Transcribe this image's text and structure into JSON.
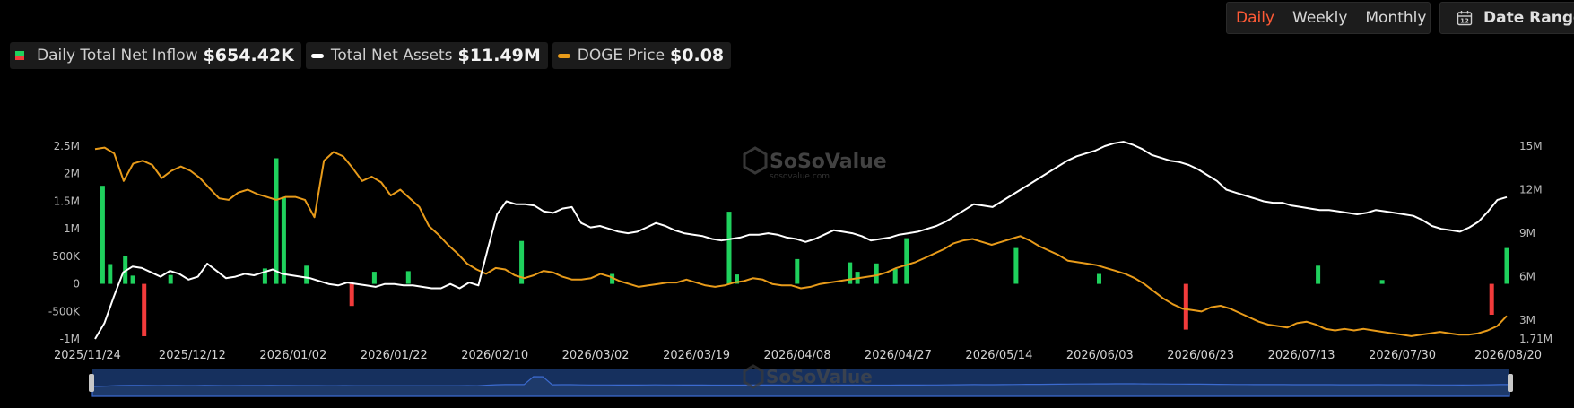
{
  "period_options": [
    {
      "label": "Daily",
      "active": true
    },
    {
      "label": "Weekly",
      "active": false
    },
    {
      "label": "Monthly",
      "active": false
    }
  ],
  "date_range_label": "Date Range",
  "date_range_icon": "calendar-icon",
  "legend": [
    {
      "label": "Daily Total Net Inflow",
      "value": "$654.42K"
    },
    {
      "label": "Total Net Assets",
      "value": "$11.49M"
    },
    {
      "label": "DOGE Price",
      "value": "$0.08"
    }
  ],
  "watermark": {
    "brand": "SoSoValue",
    "site": "sosovalue.com"
  },
  "colors": {
    "inflow_positive": "#1fd15d",
    "inflow_negative": "#f23b3b",
    "net_assets": "#ffffff",
    "doge_price": "#e89b1a",
    "navigator_fill": "#1e3a6a",
    "navigator_line": "#3c6bd0"
  },
  "chart_data": {
    "type": "bar+line",
    "x_labels": [
      "2025/11/24",
      "2025/12/12",
      "2026/01/02",
      "2026/01/22",
      "2026/02/10",
      "2026/03/02",
      "2026/03/19",
      "2026/04/08",
      "2026/04/27",
      "2026/05/14",
      "2026/06/03",
      "2026/06/23",
      "2026/07/13",
      "2026/07/30",
      "2026/08/20"
    ],
    "left_axis": {
      "ticks": [
        "2.5M",
        "2M",
        "1.5M",
        "1M",
        "500K",
        "0",
        "-500K",
        "-1M"
      ],
      "min": -1000000,
      "max": 2500000
    },
    "right_axis": {
      "ticks": [
        "15M",
        "12M",
        "9M",
        "6M",
        "3M",
        "1.71M"
      ],
      "min": 1710000,
      "max": 15000000
    },
    "series": [
      {
        "name": "Daily Total Net Inflow",
        "kind": "bar",
        "axis": "left",
        "points": [
          [
            2,
            1780000
          ],
          [
            4,
            360000
          ],
          [
            8,
            500000
          ],
          [
            10,
            150000
          ],
          [
            13,
            -950000
          ],
          [
            20,
            160000
          ],
          [
            45,
            280000
          ],
          [
            48,
            2280000
          ],
          [
            50,
            1580000
          ],
          [
            56,
            330000
          ],
          [
            68,
            -400000
          ],
          [
            74,
            220000
          ],
          [
            83,
            230000
          ],
          [
            113,
            780000
          ],
          [
            137,
            180000
          ],
          [
            168,
            1310000
          ],
          [
            170,
            170000
          ],
          [
            186,
            450000
          ],
          [
            200,
            390000
          ],
          [
            202,
            220000
          ],
          [
            207,
            370000
          ],
          [
            212,
            270000
          ],
          [
            215,
            830000
          ],
          [
            244,
            650000
          ],
          [
            266,
            180000
          ],
          [
            289,
            -830000
          ],
          [
            324,
            330000
          ],
          [
            341,
            70000
          ],
          [
            370,
            -560000
          ],
          [
            374,
            650000
          ]
        ]
      },
      {
        "name": "Total Net Assets",
        "kind": "line",
        "axis": "right",
        "x_range": [
          0,
          374
        ],
        "values": [
          1.71,
          2.8,
          4.6,
          6.3,
          6.7,
          6.6,
          6.3,
          6.0,
          6.4,
          6.2,
          5.8,
          6.0,
          6.9,
          6.4,
          5.9,
          6.0,
          6.2,
          6.1,
          6.3,
          6.5,
          6.2,
          6.1,
          6.0,
          5.9,
          5.7,
          5.5,
          5.4,
          5.6,
          5.5,
          5.4,
          5.3,
          5.5,
          5.5,
          5.4,
          5.4,
          5.3,
          5.2,
          5.2,
          5.5,
          5.2,
          5.6,
          5.4,
          7.9,
          10.3,
          11.2,
          11.0,
          11.0,
          10.9,
          10.5,
          10.4,
          10.7,
          10.8,
          9.7,
          9.4,
          9.5,
          9.3,
          9.1,
          9.0,
          9.1,
          9.4,
          9.7,
          9.5,
          9.2,
          9.0,
          8.9,
          8.8,
          8.6,
          8.5,
          8.6,
          8.7,
          8.9,
          8.9,
          9.0,
          8.9,
          8.7,
          8.6,
          8.4,
          8.6,
          8.9,
          9.2,
          9.1,
          9.0,
          8.8,
          8.5,
          8.6,
          8.7,
          8.9,
          9.0,
          9.1,
          9.3,
          9.5,
          9.8,
          10.2,
          10.6,
          11.0,
          10.9,
          10.8,
          11.2,
          11.6,
          12.0,
          12.4,
          12.8,
          13.2,
          13.6,
          14.0,
          14.3,
          14.5,
          14.7,
          15.0,
          15.2,
          15.3,
          15.1,
          14.8,
          14.4,
          14.2,
          14.0,
          13.9,
          13.7,
          13.4,
          13.0,
          12.6,
          12.0,
          11.8,
          11.6,
          11.4,
          11.2,
          11.1,
          11.1,
          10.9,
          10.8,
          10.7,
          10.6,
          10.6,
          10.5,
          10.4,
          10.3,
          10.4,
          10.6,
          10.5,
          10.4,
          10.3,
          10.2,
          9.9,
          9.5,
          9.3,
          9.2,
          9.1,
          9.4,
          9.8,
          10.5,
          11.3,
          11.49
        ]
      },
      {
        "name": "DOGE Price",
        "kind": "line",
        "axis": "right",
        "x_range": [
          0,
          374
        ],
        "values": [
          14.8,
          14.9,
          14.5,
          12.6,
          13.8,
          14.0,
          13.7,
          12.8,
          13.3,
          13.6,
          13.3,
          12.8,
          12.1,
          11.4,
          11.3,
          11.8,
          12.0,
          11.7,
          11.5,
          11.3,
          11.5,
          11.5,
          11.3,
          10.1,
          14.0,
          14.6,
          14.3,
          13.5,
          12.6,
          12.9,
          12.5,
          11.6,
          12.0,
          11.4,
          10.8,
          9.5,
          8.9,
          8.2,
          7.6,
          6.9,
          6.5,
          6.2,
          6.6,
          6.5,
          6.1,
          5.9,
          6.1,
          6.4,
          6.3,
          6.0,
          5.8,
          5.8,
          5.9,
          6.2,
          6.0,
          5.7,
          5.5,
          5.3,
          5.4,
          5.5,
          5.6,
          5.6,
          5.8,
          5.6,
          5.4,
          5.3,
          5.4,
          5.6,
          5.7,
          5.9,
          5.8,
          5.5,
          5.4,
          5.4,
          5.2,
          5.3,
          5.5,
          5.6,
          5.7,
          5.8,
          5.9,
          6.0,
          6.1,
          6.3,
          6.6,
          6.8,
          7.0,
          7.3,
          7.6,
          7.9,
          8.3,
          8.5,
          8.6,
          8.4,
          8.2,
          8.4,
          8.6,
          8.8,
          8.5,
          8.1,
          7.8,
          7.5,
          7.1,
          7.0,
          6.9,
          6.8,
          6.6,
          6.4,
          6.2,
          5.9,
          5.5,
          5.0,
          4.5,
          4.1,
          3.8,
          3.7,
          3.6,
          3.9,
          4.0,
          3.8,
          3.5,
          3.2,
          2.9,
          2.7,
          2.6,
          2.5,
          2.8,
          2.9,
          2.7,
          2.4,
          2.3,
          2.4,
          2.3,
          2.4,
          2.3,
          2.2,
          2.1,
          2.0,
          1.9,
          2.0,
          2.1,
          2.2,
          2.1,
          2.0,
          2.0,
          2.1,
          2.3,
          2.6,
          3.3
        ]
      }
    ],
    "grid": false,
    "legend_position": "top-left"
  }
}
